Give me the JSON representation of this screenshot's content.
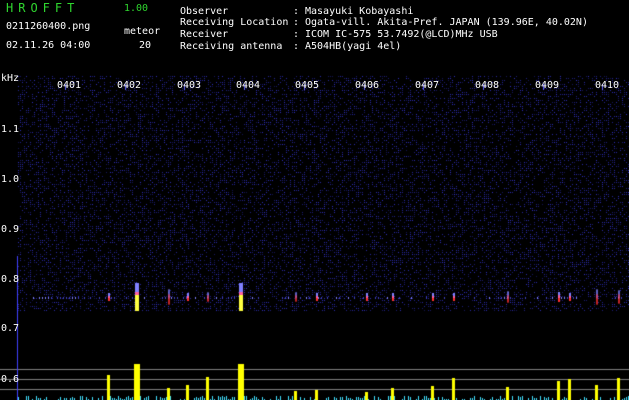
{
  "header": {
    "title": "HROFFT",
    "version": "1.00",
    "filename": "0211260400.png",
    "meteor_label": "meteor",
    "meteor_count": "20",
    "datetime": "02.11.26 04:00"
  },
  "info": [
    {
      "key": "Observer",
      "value": "Masayuki Kobayashi"
    },
    {
      "key": "Receiving Location",
      "value": "Ogata-vill. Akita-Pref. JAPAN (139.96E, 40.02N)"
    },
    {
      "key": "Receiver",
      "value": "ICOM IC-575 53.7492(@LCD)MHz USB"
    },
    {
      "key": "Receiving antenna",
      "value": "A504HB(yagi 4el)"
    }
  ],
  "separator": ":",
  "spectrogram": {
    "unit_label": "kHz",
    "time_ticks": [
      "0401",
      "0402",
      "0403",
      "0404",
      "0405",
      "0406",
      "0407",
      "0408",
      "0409",
      "0410"
    ],
    "freq_ticks": [
      "1.1",
      "1.0",
      "0.9",
      "0.8",
      "0.7",
      "0.6"
    ],
    "colors": {
      "background": "#000000",
      "noise": "#2a2aa8",
      "echo": "#ff4080",
      "bars": "#ffff00",
      "baseline": "#40e0ff"
    },
    "meteor_events_minutes": [
      0.72,
      1.18,
      1.73,
      2.05,
      2.38,
      2.92,
      3.85,
      4.2,
      5.04,
      5.48,
      6.15,
      6.5,
      7.4,
      8.25,
      8.45,
      8.9,
      9.26,
      9.5,
      9.83
    ]
  }
}
